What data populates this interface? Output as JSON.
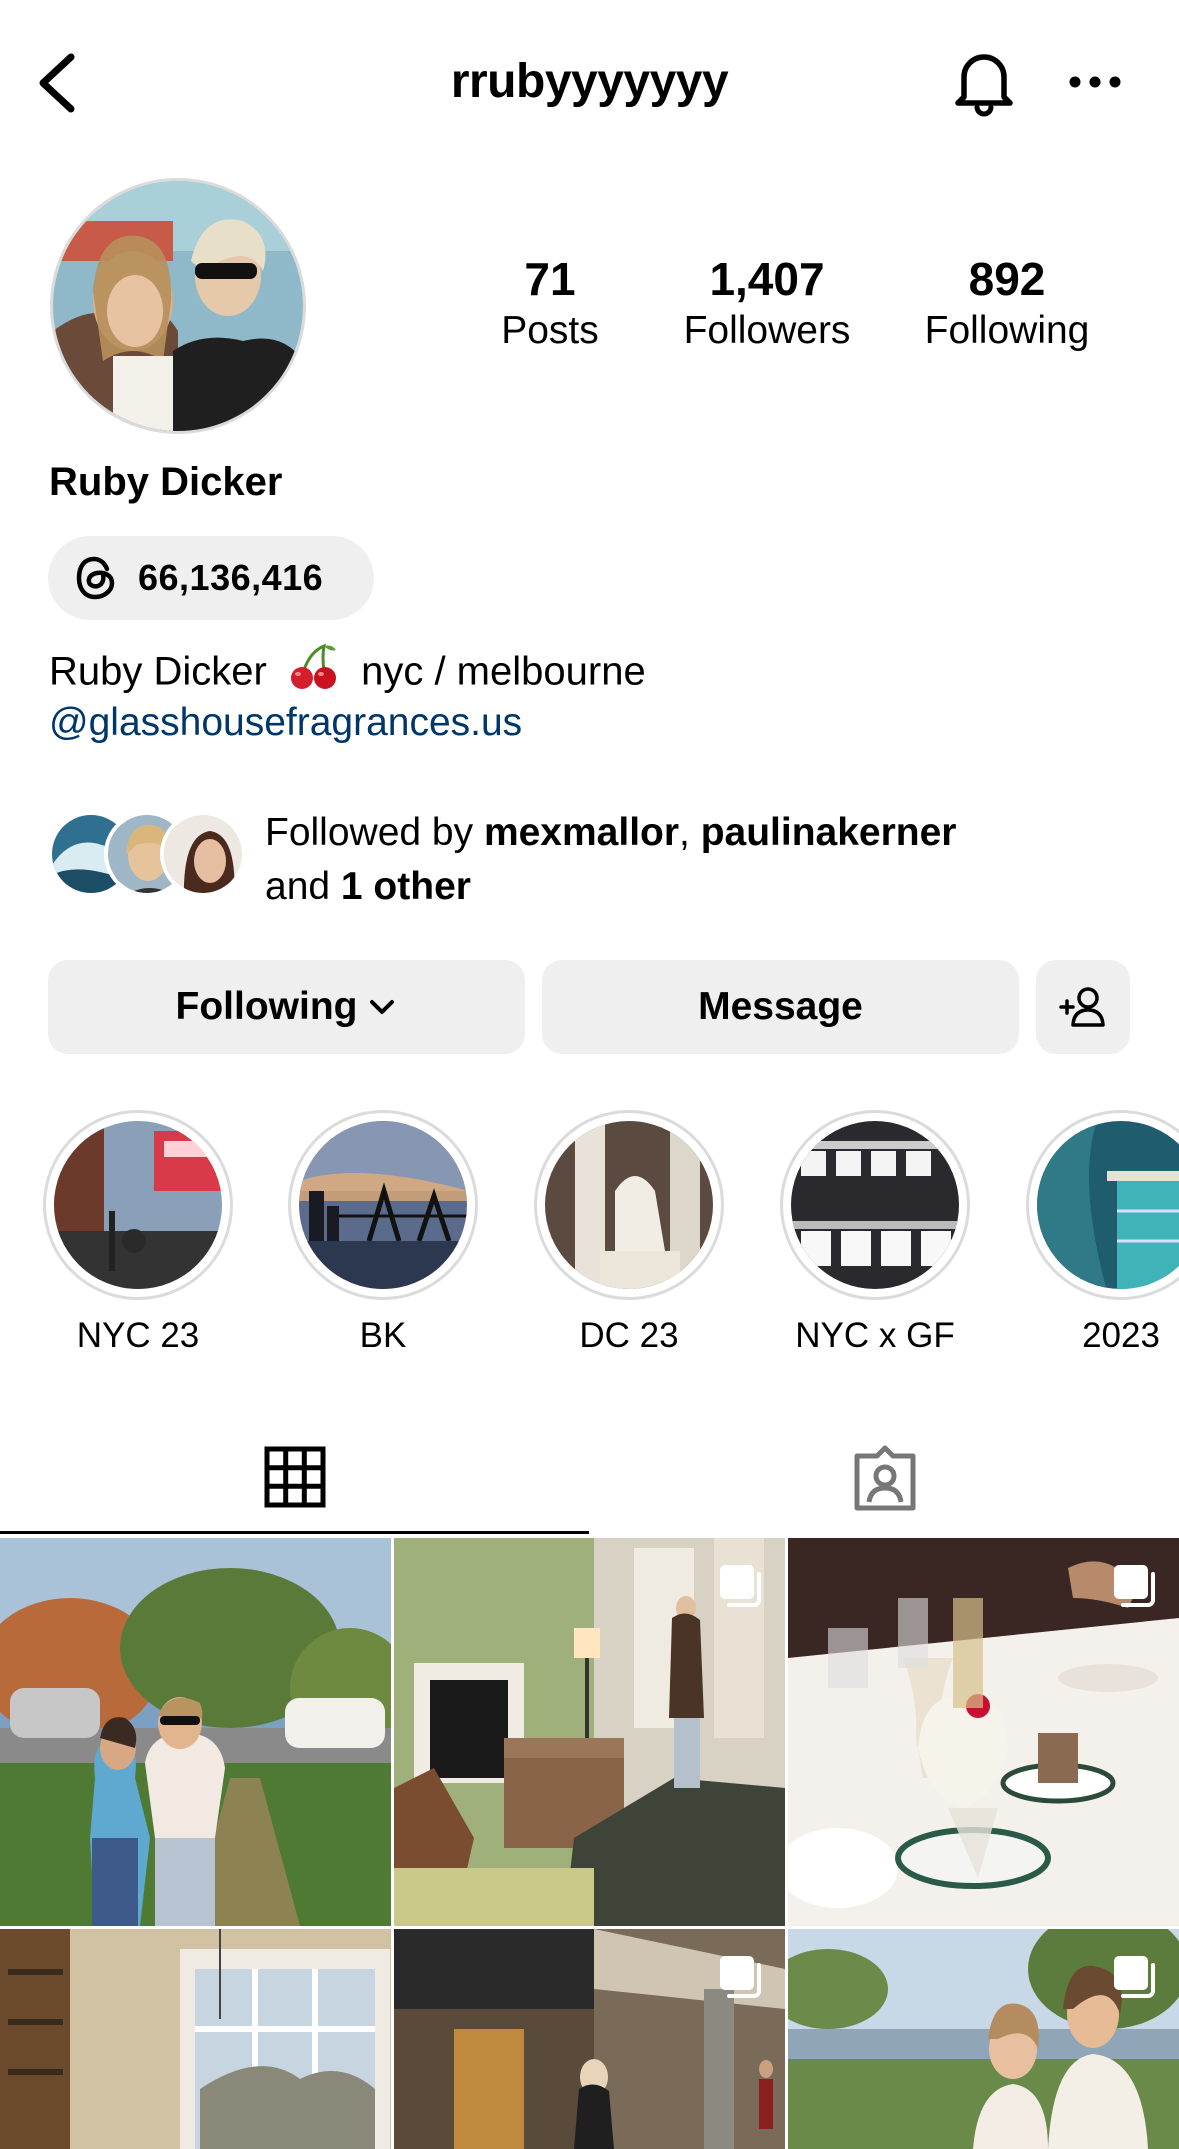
{
  "header": {
    "username": "rrubyyyyyyy",
    "back_icon": "chevron-left-icon",
    "bell_icon": "bell-icon",
    "more_icon": "more-horizontal-icon"
  },
  "stats": {
    "posts": {
      "value": "71",
      "label": "Posts"
    },
    "followers": {
      "value": "1,407",
      "label": "Followers"
    },
    "following": {
      "value": "892",
      "label": "Following"
    }
  },
  "profile": {
    "full_name": "Ruby Dicker",
    "threads_count": "66,136,416",
    "bio_before": "Ruby Dicker",
    "bio_emoji": "cherries",
    "bio_after": "nyc / melbourne",
    "bio_link": "@glasshousefragrances.us"
  },
  "mutuals": {
    "prefix": "Followed by ",
    "user1": "mexmallor",
    "sep": ", ",
    "user2": "paulinakerner",
    "and_text": "and ",
    "others": "1 other"
  },
  "actions": {
    "following_label": "Following",
    "message_label": "Message",
    "add_user_icon": "add-person-icon"
  },
  "highlights": [
    {
      "label": "NYC 23"
    },
    {
      "label": "BK"
    },
    {
      "label": "DC 23"
    },
    {
      "label": "NYC x GF"
    },
    {
      "label": "2023"
    }
  ],
  "tabs": {
    "grid_icon": "grid-icon",
    "tagged_icon": "tagged-person-icon"
  },
  "colors": {
    "link": "#00376b",
    "button_bg": "#efefef",
    "divider": "#dbdbdb"
  }
}
